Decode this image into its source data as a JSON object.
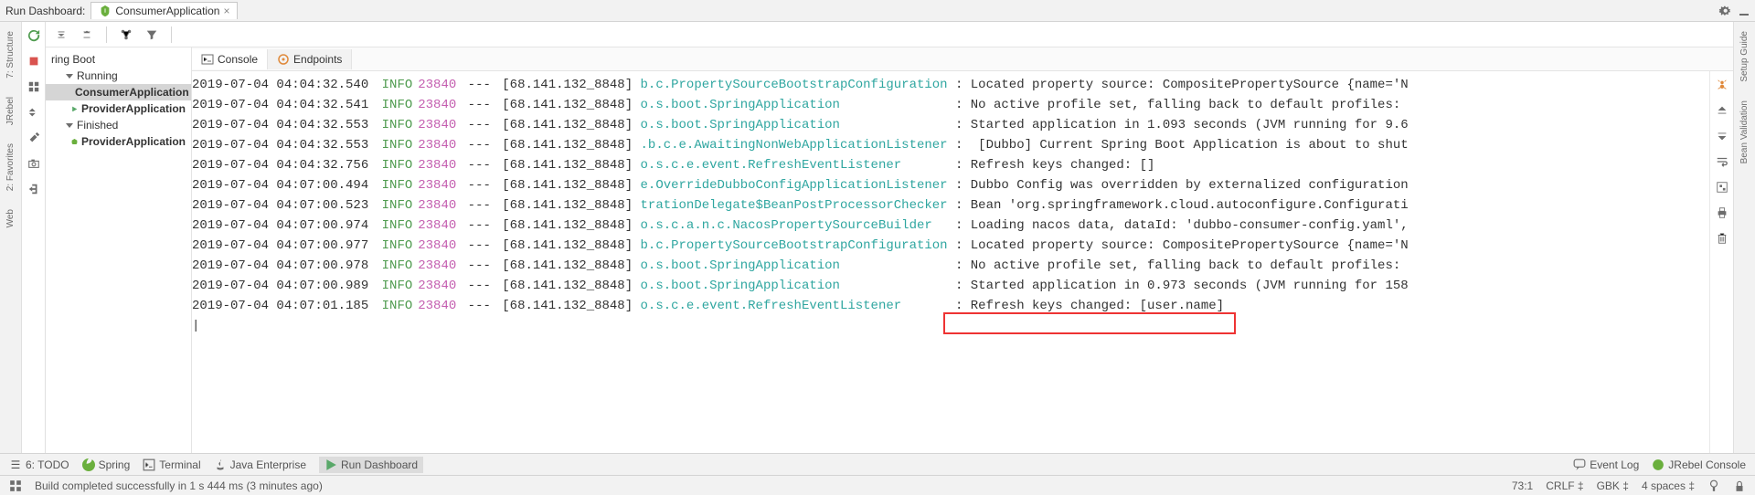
{
  "topbar": {
    "title": "Run Dashboard:",
    "tab_label": "ConsumerApplication",
    "tab_close": "×"
  },
  "left_tools": {
    "structure": "7: Structure",
    "jrebel": "JRebel",
    "favorites": "2: Favorites",
    "web": "Web"
  },
  "right_tools": {
    "setup": "Setup Guide",
    "bean": "Bean Validation"
  },
  "tree": {
    "root_label": "ring Boot",
    "running": "Running",
    "consumer": "ConsumerApplication",
    "provider": "ProviderApplication",
    "finished": "Finished",
    "provider2": "ProviderApplication"
  },
  "console": {
    "tab_console": "Console",
    "tab_endpoints": "Endpoints"
  },
  "log": {
    "lines": [
      {
        "ts": "2019-07-04 04:04:32.540",
        "lvl": "INFO",
        "pid": "23840",
        "sep": "---",
        "thr": "[68.141.132_8848]",
        "logger": "b.c.PropertySourceBootstrapConfiguration",
        "msg": ": Located property source: CompositePropertySource {name='N"
      },
      {
        "ts": "2019-07-04 04:04:32.541",
        "lvl": "INFO",
        "pid": "23840",
        "sep": "---",
        "thr": "[68.141.132_8848]",
        "logger": "o.s.boot.SpringApplication",
        "msg": ": No active profile set, falling back to default profiles: "
      },
      {
        "ts": "2019-07-04 04:04:32.553",
        "lvl": "INFO",
        "pid": "23840",
        "sep": "---",
        "thr": "[68.141.132_8848]",
        "logger": "o.s.boot.SpringApplication",
        "msg": ": Started application in 1.093 seconds (JVM running for 9.6"
      },
      {
        "ts": "2019-07-04 04:04:32.553",
        "lvl": "INFO",
        "pid": "23840",
        "sep": "---",
        "thr": "[68.141.132_8848]",
        "logger": ".b.c.e.AwaitingNonWebApplicationListener",
        "msg": ":  [Dubbo] Current Spring Boot Application is about to shut"
      },
      {
        "ts": "2019-07-04 04:04:32.756",
        "lvl": "INFO",
        "pid": "23840",
        "sep": "---",
        "thr": "[68.141.132_8848]",
        "logger": "o.s.c.e.event.RefreshEventListener",
        "msg": ": Refresh keys changed: []"
      },
      {
        "ts": "2019-07-04 04:07:00.494",
        "lvl": "INFO",
        "pid": "23840",
        "sep": "---",
        "thr": "[68.141.132_8848]",
        "logger": "e.OverrideDubboConfigApplicationListener",
        "msg": ": Dubbo Config was overridden by externalized configuration"
      },
      {
        "ts": "2019-07-04 04:07:00.523",
        "lvl": "INFO",
        "pid": "23840",
        "sep": "---",
        "thr": "[68.141.132_8848]",
        "logger": "trationDelegate$BeanPostProcessorChecker",
        "msg": ": Bean 'org.springframework.cloud.autoconfigure.Configurati"
      },
      {
        "ts": "2019-07-04 04:07:00.974",
        "lvl": "INFO",
        "pid": "23840",
        "sep": "---",
        "thr": "[68.141.132_8848]",
        "logger": "o.s.c.a.n.c.NacosPropertySourceBuilder",
        "msg": ": Loading nacos data, dataId: 'dubbo-consumer-config.yaml',"
      },
      {
        "ts": "2019-07-04 04:07:00.977",
        "lvl": "INFO",
        "pid": "23840",
        "sep": "---",
        "thr": "[68.141.132_8848]",
        "logger": "b.c.PropertySourceBootstrapConfiguration",
        "msg": ": Located property source: CompositePropertySource {name='N"
      },
      {
        "ts": "2019-07-04 04:07:00.978",
        "lvl": "INFO",
        "pid": "23840",
        "sep": "---",
        "thr": "[68.141.132_8848]",
        "logger": "o.s.boot.SpringApplication",
        "msg": ": No active profile set, falling back to default profiles: "
      },
      {
        "ts": "2019-07-04 04:07:00.989",
        "lvl": "INFO",
        "pid": "23840",
        "sep": "---",
        "thr": "[68.141.132_8848]",
        "logger": "o.s.boot.SpringApplication",
        "msg": ": Started application in 0.973 seconds (JVM running for 158"
      },
      {
        "ts": "2019-07-04 04:07:01.185",
        "lvl": "INFO",
        "pid": "23840",
        "sep": "---",
        "thr": "[68.141.132_8848]",
        "logger": "o.s.c.e.event.RefreshEventListener",
        "msg": ": Refresh keys changed: [user.name]"
      }
    ],
    "colon_gap": "  "
  },
  "bottom": {
    "todo": "6: TODO",
    "spring": "Spring",
    "terminal": "Terminal",
    "java": "Java Enterprise",
    "run": "Run Dashboard",
    "eventlog": "Event Log",
    "jrebel": "JRebel Console"
  },
  "status": {
    "msg": "Build completed successfully in 1 s 444 ms (3 minutes ago)",
    "pos": "73:1",
    "crlf": "CRLF",
    "enc": "GBK",
    "indent": "4 spaces"
  }
}
